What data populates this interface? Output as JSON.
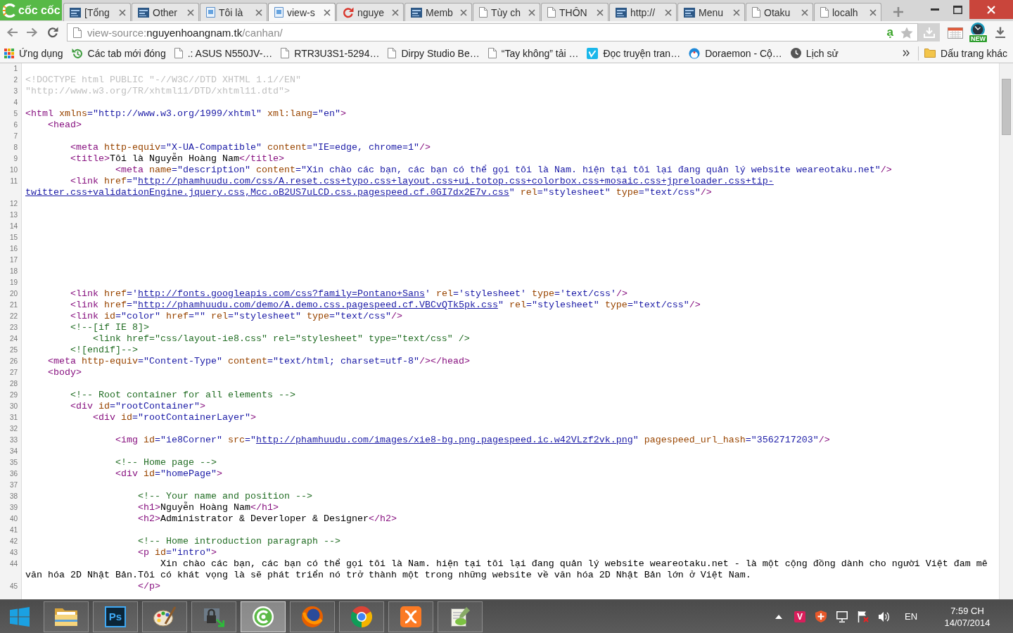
{
  "window": {
    "brand": "cốc cốc"
  },
  "tabs": [
    {
      "kind": "tile",
      "label": "[Tổng",
      "selected": false
    },
    {
      "kind": "tile",
      "label": "Other",
      "selected": false
    },
    {
      "kind": "picture",
      "label": "Tôi là",
      "selected": false
    },
    {
      "kind": "picture",
      "label": "view-s",
      "selected": true
    },
    {
      "kind": "sync",
      "label": "nguye",
      "selected": false
    },
    {
      "kind": "tile",
      "label": "Memb",
      "selected": false
    },
    {
      "kind": "page",
      "label": "Tùy ch",
      "selected": false
    },
    {
      "kind": "page",
      "label": "THÔN",
      "selected": false
    },
    {
      "kind": "tile",
      "label": "http://",
      "selected": false
    },
    {
      "kind": "tile",
      "label": "Menu",
      "selected": false
    },
    {
      "kind": "page",
      "label": "Otaku",
      "selected": false
    },
    {
      "kind": "page",
      "label": "localh",
      "selected": false
    }
  ],
  "toolbar": {
    "address": {
      "scheme": "view-source:",
      "host": "nguyenhoangnam.tk",
      "path": "/canhan/"
    },
    "typing_mode": "ạ",
    "extension_badge": "NEW"
  },
  "bookmarks": {
    "items": [
      {
        "kind": "apps",
        "label": "Ứng dụng"
      },
      {
        "kind": "history",
        "label": "Các tab mới đóng"
      },
      {
        "kind": "page",
        "label": ".: ASUS N550JV-…"
      },
      {
        "kind": "page",
        "label": "RTR3U3S1-5294…"
      },
      {
        "kind": "page",
        "label": "Dirpy Studio Be…"
      },
      {
        "kind": "page",
        "label": "“Tay không” tải …"
      },
      {
        "kind": "tile",
        "label": "Đọc truyện tran…"
      },
      {
        "kind": "round",
        "label": "Doraemon - Cộ…"
      },
      {
        "kind": "clock",
        "label": "Lịch sử"
      }
    ],
    "other_bookmarks": "Dấu trang khác"
  },
  "source": {
    "lines": [
      {
        "number": "1"
      },
      {
        "number": "2",
        "tokens": [
          {
            "kind": "doctype",
            "text": "<!DOCTYPE html PUBLIC \"-//W3C//DTD XHTML 1.1//EN\""
          }
        ]
      },
      {
        "number": "3",
        "tokens": [
          {
            "kind": "doctype",
            "text": "\"http://www.w3.org/TR/xhtml11/DTD/xhtml11.dtd\">"
          }
        ]
      },
      {
        "number": "4"
      },
      {
        "number": "5",
        "tokens": [
          {
            "kind": "tag",
            "text": "<html "
          },
          {
            "kind": "attribute",
            "text": "xmlns"
          },
          {
            "kind": "value",
            "text": "=\"http://www.w3.org/1999/xhtml\" "
          },
          {
            "kind": "attribute",
            "text": "xml:lang"
          },
          {
            "kind": "value",
            "text": "=\"en\""
          },
          {
            "kind": "tag",
            "text": ">"
          }
        ]
      },
      {
        "number": "6",
        "tokens": [
          {
            "kind": "tag",
            "text": "    <head>"
          }
        ]
      },
      {
        "number": "7"
      },
      {
        "number": "8",
        "tokens": [
          {
            "kind": "tag",
            "text": "        <meta "
          },
          {
            "kind": "attribute",
            "text": "http-equiv"
          },
          {
            "kind": "value",
            "text": "=\"X-UA-Compatible\" "
          },
          {
            "kind": "attribute",
            "text": "content"
          },
          {
            "kind": "value",
            "text": "=\"IE=edge, chrome=1\""
          },
          {
            "kind": "tag",
            "text": "/>"
          }
        ]
      },
      {
        "number": "9",
        "tokens": [
          {
            "kind": "tag",
            "text": "        <title>"
          },
          {
            "kind": "text",
            "text": "Tôi là Nguyễn Hoàng Nam"
          },
          {
            "kind": "tag",
            "text": "</title>"
          }
        ]
      },
      {
        "number": "10",
        "tokens": [
          {
            "kind": "tag",
            "text": "                <meta "
          },
          {
            "kind": "attribute",
            "text": "name"
          },
          {
            "kind": "value",
            "text": "=\"description\" "
          },
          {
            "kind": "attribute",
            "text": "content"
          },
          {
            "kind": "value",
            "text": "=\"Xin chào các bạn, các bạn có thể gọi tôi là Nam. hiện tại tôi lại đang quản lý website weareotaku.net\""
          },
          {
            "kind": "tag",
            "text": "/>"
          }
        ]
      },
      {
        "number": "11",
        "tokens": [
          {
            "kind": "tag",
            "text": "        <link "
          },
          {
            "kind": "attribute",
            "text": "href"
          },
          {
            "kind": "value",
            "text": "=\""
          },
          {
            "kind": "link",
            "text": "http://phamhuudu.com/css/A.reset.css+typo.css+layout.css+ui.totop.css+colorbox.css+mosaic.css+jpreloader.css+tip-"
          },
          {
            "kind": "link",
            "text": "twitter.css+validationEngine.jquery.css,Mcc.oB2US7uLCD.css.pagespeed.cf.0GI7dx2E7v.css"
          },
          {
            "kind": "value",
            "text": "\" "
          },
          {
            "kind": "attribute",
            "text": "rel"
          },
          {
            "kind": "value",
            "text": "=\"stylesheet\" "
          },
          {
            "kind": "attribute",
            "text": "type"
          },
          {
            "kind": "value",
            "text": "=\"text/css\""
          },
          {
            "kind": "tag",
            "text": "/>"
          }
        ]
      },
      {
        "number": "12"
      },
      {
        "number": "13"
      },
      {
        "number": "14"
      },
      {
        "number": "15"
      },
      {
        "number": "16"
      },
      {
        "number": "17"
      },
      {
        "number": "18"
      },
      {
        "number": "19"
      },
      {
        "number": "20",
        "tokens": [
          {
            "kind": "tag",
            "text": "        <link "
          },
          {
            "kind": "attribute",
            "text": "href"
          },
          {
            "kind": "value",
            "text": "='"
          },
          {
            "kind": "link",
            "text": "http://fonts.googleapis.com/css?family=Pontano+Sans"
          },
          {
            "kind": "value",
            "text": "' "
          },
          {
            "kind": "attribute",
            "text": "rel"
          },
          {
            "kind": "value",
            "text": "='stylesheet' "
          },
          {
            "kind": "attribute",
            "text": "type"
          },
          {
            "kind": "value",
            "text": "='text/css'"
          },
          {
            "kind": "tag",
            "text": "/>"
          }
        ]
      },
      {
        "number": "21",
        "tokens": [
          {
            "kind": "tag",
            "text": "        <link "
          },
          {
            "kind": "attribute",
            "text": "href"
          },
          {
            "kind": "value",
            "text": "=\""
          },
          {
            "kind": "link",
            "text": "http://phamhuudu.com/demo/A.demo.css.pagespeed.cf.VBCvQTk5pk.css"
          },
          {
            "kind": "value",
            "text": "\" "
          },
          {
            "kind": "attribute",
            "text": "rel"
          },
          {
            "kind": "value",
            "text": "=\"stylesheet\" "
          },
          {
            "kind": "attribute",
            "text": "type"
          },
          {
            "kind": "value",
            "text": "=\"text/css\""
          },
          {
            "kind": "tag",
            "text": "/>"
          }
        ]
      },
      {
        "number": "22",
        "tokens": [
          {
            "kind": "tag",
            "text": "        <link "
          },
          {
            "kind": "attribute",
            "text": "id"
          },
          {
            "kind": "value",
            "text": "=\"color\" "
          },
          {
            "kind": "attribute",
            "text": "href"
          },
          {
            "kind": "value",
            "text": "=\"\" "
          },
          {
            "kind": "attribute",
            "text": "rel"
          },
          {
            "kind": "value",
            "text": "=\"stylesheet\" "
          },
          {
            "kind": "attribute",
            "text": "type"
          },
          {
            "kind": "value",
            "text": "=\"text/css\""
          },
          {
            "kind": "tag",
            "text": "/>"
          }
        ]
      },
      {
        "number": "23",
        "tokens": [
          {
            "kind": "comment",
            "text": "        <!--[if IE 8]>"
          }
        ]
      },
      {
        "number": "24",
        "tokens": [
          {
            "kind": "comment",
            "text": "            <link href=\"css/layout-ie8.css\" rel=\"stylesheet\" type=\"text/css\" />"
          }
        ]
      },
      {
        "number": "25",
        "tokens": [
          {
            "kind": "comment",
            "text": "        <![endif]-->"
          }
        ]
      },
      {
        "number": "26",
        "tokens": [
          {
            "kind": "tag",
            "text": "    <meta "
          },
          {
            "kind": "attribute",
            "text": "http-equiv"
          },
          {
            "kind": "value",
            "text": "=\"Content-Type\" "
          },
          {
            "kind": "attribute",
            "text": "content"
          },
          {
            "kind": "value",
            "text": "=\"text/html; charset=utf-8\""
          },
          {
            "kind": "tag",
            "text": "/></head>"
          }
        ]
      },
      {
        "number": "27",
        "tokens": [
          {
            "kind": "tag",
            "text": "    <body>"
          }
        ]
      },
      {
        "number": "28"
      },
      {
        "number": "29",
        "tokens": [
          {
            "kind": "comment",
            "text": "        <!-- Root container for all elements -->"
          }
        ]
      },
      {
        "number": "30",
        "tokens": [
          {
            "kind": "tag",
            "text": "        <div "
          },
          {
            "kind": "attribute",
            "text": "id"
          },
          {
            "kind": "value",
            "text": "=\"rootContainer\""
          },
          {
            "kind": "tag",
            "text": ">"
          }
        ]
      },
      {
        "number": "31",
        "tokens": [
          {
            "kind": "tag",
            "text": "            <div "
          },
          {
            "kind": "attribute",
            "text": "id"
          },
          {
            "kind": "value",
            "text": "=\"rootContainerLayer\""
          },
          {
            "kind": "tag",
            "text": ">"
          }
        ]
      },
      {
        "number": "32"
      },
      {
        "number": "33",
        "tokens": [
          {
            "kind": "tag",
            "text": "                <img "
          },
          {
            "kind": "attribute",
            "text": "id"
          },
          {
            "kind": "value",
            "text": "=\"ie8Corner\" "
          },
          {
            "kind": "attribute",
            "text": "src"
          },
          {
            "kind": "value",
            "text": "=\""
          },
          {
            "kind": "link",
            "text": "http://phamhuudu.com/images/xie8-bg.png.pagespeed.ic.w42VLzf2vk.png"
          },
          {
            "kind": "value",
            "text": "\" "
          },
          {
            "kind": "attribute",
            "text": "pagespeed_url_hash"
          },
          {
            "kind": "value",
            "text": "=\"3562717203\""
          },
          {
            "kind": "tag",
            "text": "/>"
          }
        ]
      },
      {
        "number": "34"
      },
      {
        "number": "35",
        "tokens": [
          {
            "kind": "comment",
            "text": "                <!-- Home page -->"
          }
        ]
      },
      {
        "number": "36",
        "tokens": [
          {
            "kind": "tag",
            "text": "                <div "
          },
          {
            "kind": "attribute",
            "text": "id"
          },
          {
            "kind": "value",
            "text": "=\"homePage\""
          },
          {
            "kind": "tag",
            "text": ">"
          }
        ]
      },
      {
        "number": "37"
      },
      {
        "number": "38",
        "tokens": [
          {
            "kind": "comment",
            "text": "                    <!-- Your name and position -->"
          }
        ]
      },
      {
        "number": "39",
        "tokens": [
          {
            "kind": "tag",
            "text": "                    <h1>"
          },
          {
            "kind": "text",
            "text": "Nguyễn Hoàng Nam"
          },
          {
            "kind": "tag",
            "text": "</h1>"
          }
        ]
      },
      {
        "number": "40",
        "tokens": [
          {
            "kind": "tag",
            "text": "                    <h2>"
          },
          {
            "kind": "text",
            "text": "Administrator & Deverloper & Designer"
          },
          {
            "kind": "tag",
            "text": "</h2>"
          }
        ]
      },
      {
        "number": "41"
      },
      {
        "number": "42",
        "tokens": [
          {
            "kind": "comment",
            "text": "                    <!-- Home introduction paragraph -->"
          }
        ]
      },
      {
        "number": "43",
        "tokens": [
          {
            "kind": "tag",
            "text": "                    <p "
          },
          {
            "kind": "attribute",
            "text": "id"
          },
          {
            "kind": "value",
            "text": "=\"intro\""
          },
          {
            "kind": "tag",
            "text": ">"
          }
        ]
      },
      {
        "number": "44",
        "tokens": [
          {
            "kind": "text",
            "text": "                        Xin chào các bạn, các bạn có thể gọi tôi là Nam. hiện tại tôi lại đang quản lý website weareotaku.net - là một cộng đồng dành cho người Việt đam mê văn hóa 2D Nhật Bản.Tôi có khát vọng là sẽ phát triển nó trở thành một trong những website về văn hóa 2D Nhật Bản lớn ở Việt Nam."
          }
        ]
      },
      {
        "number": "45",
        "tokens": [
          {
            "kind": "tag",
            "text": "                    </p>"
          }
        ]
      }
    ]
  },
  "taskbar": {
    "apps": [
      {
        "kind": "folder",
        "active": false
      },
      {
        "kind": "lettered",
        "label": "Ps",
        "active": false
      },
      {
        "kind": "palette",
        "active": false
      },
      {
        "kind": "padlock",
        "active": false
      },
      {
        "kind": "swirl",
        "active": true
      },
      {
        "kind": "globe",
        "active": false
      },
      {
        "kind": "ring",
        "active": false
      },
      {
        "kind": "cross",
        "active": false
      },
      {
        "kind": "notepad",
        "active": false
      }
    ],
    "tray": [
      {
        "kind": "caret"
      },
      {
        "kind": "lettered",
        "label": "V"
      },
      {
        "kind": "shield"
      },
      {
        "kind": "monitor"
      },
      {
        "kind": "flag"
      },
      {
        "kind": "speaker"
      }
    ],
    "language": "EN",
    "clock": {
      "time": "7:59 CH",
      "date": "14/07/2014"
    }
  }
}
